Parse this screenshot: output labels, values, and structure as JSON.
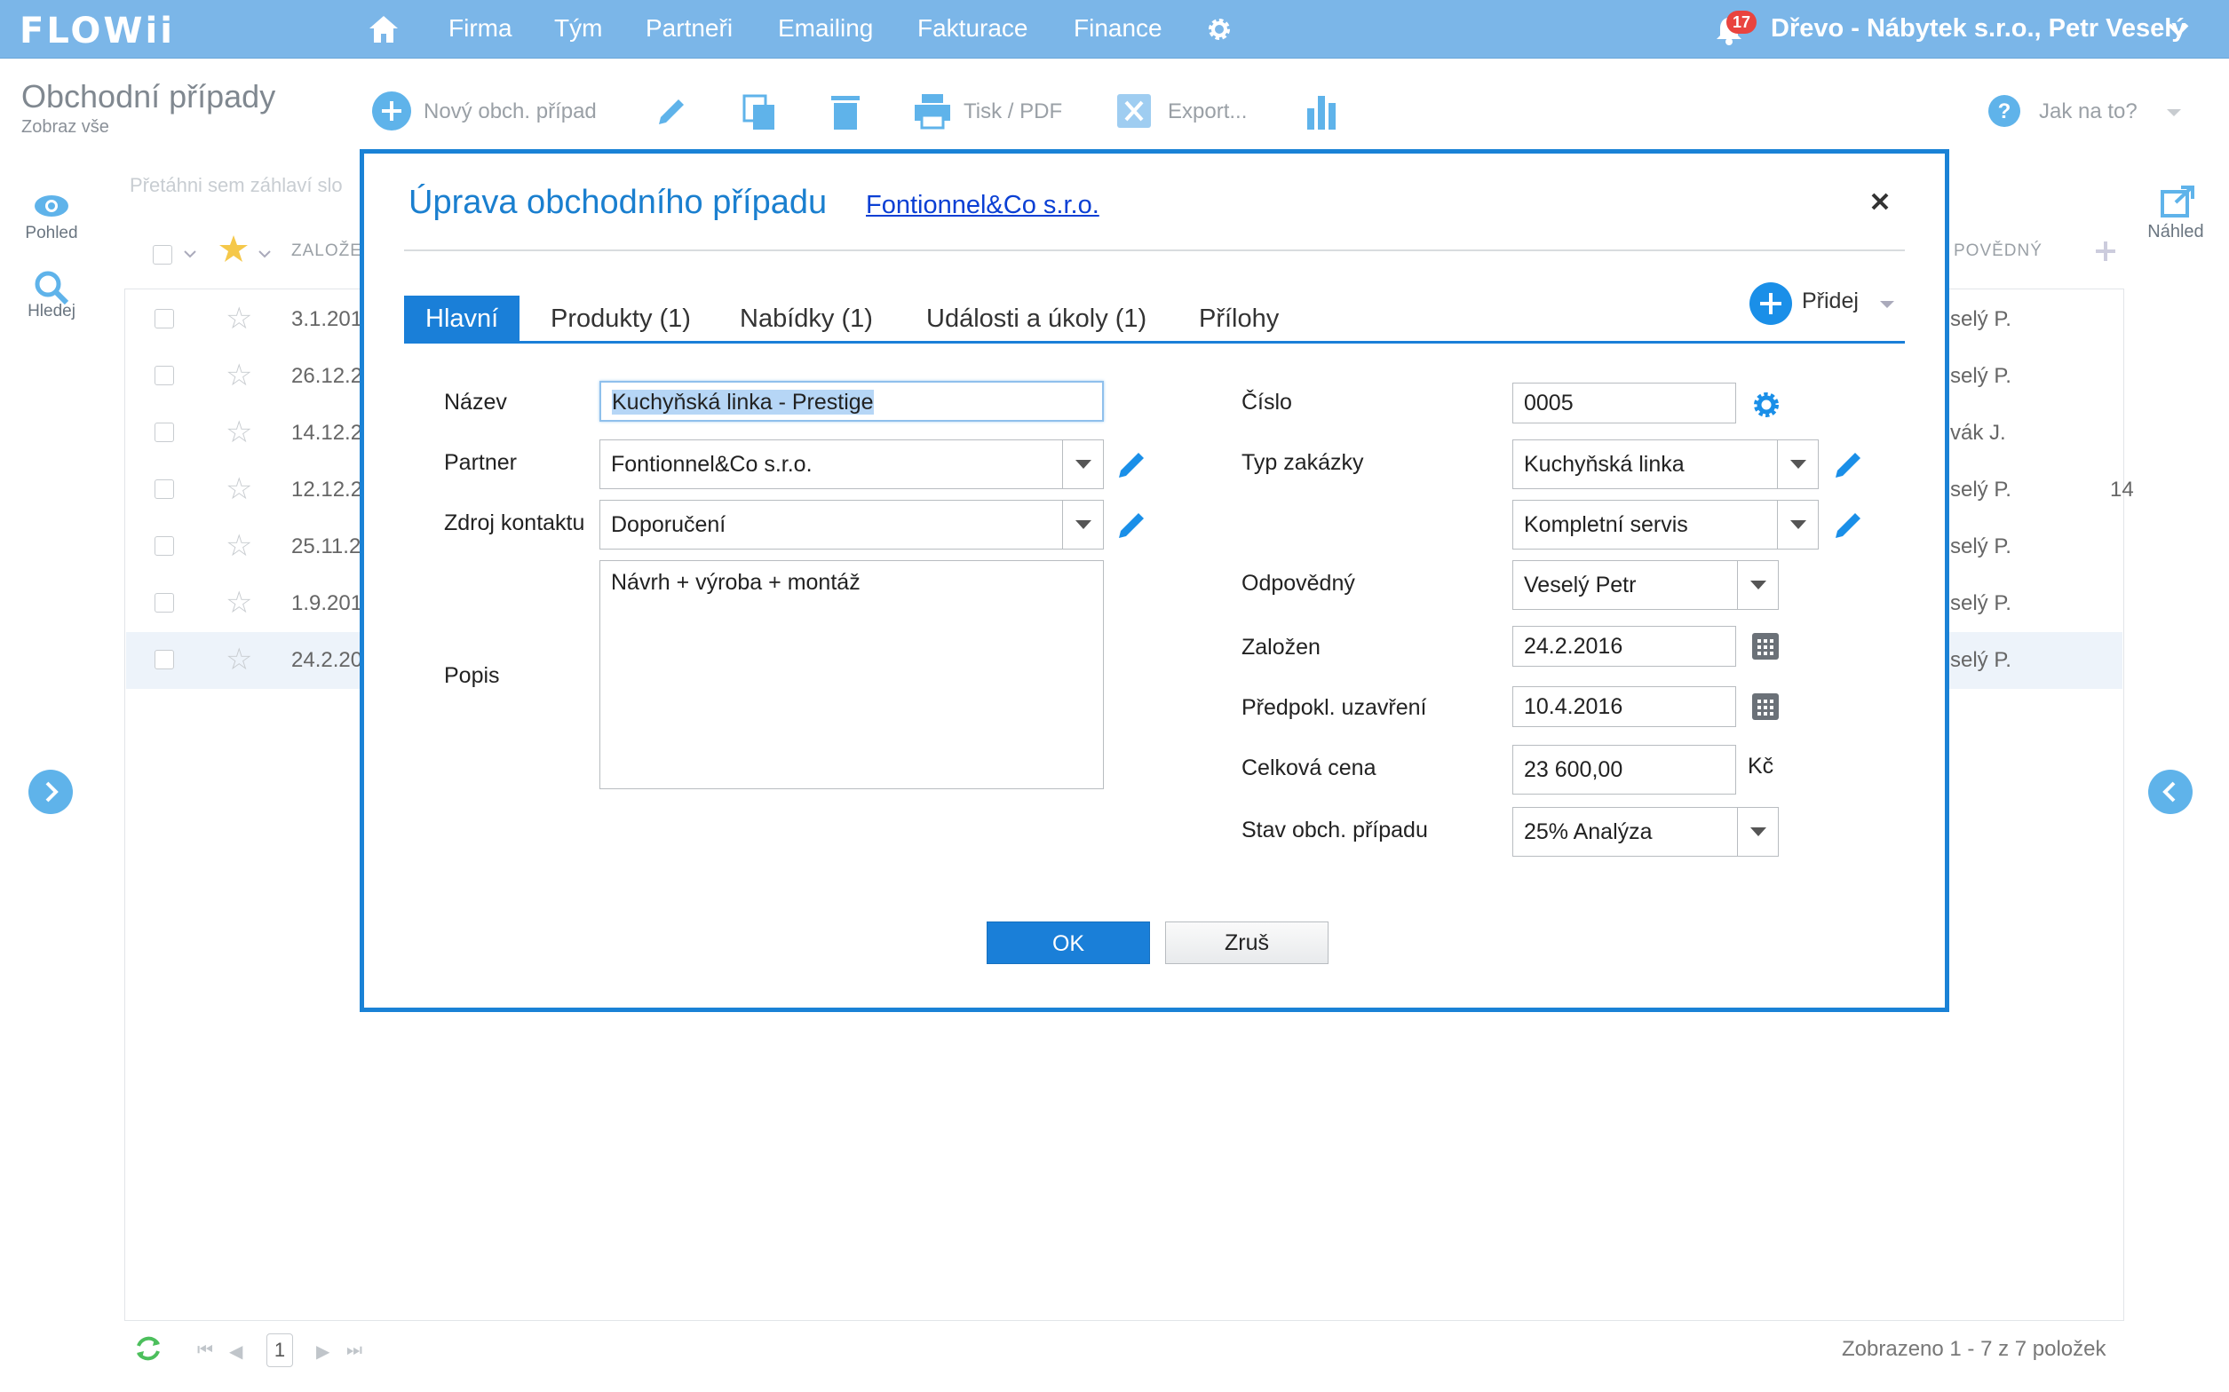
{
  "app": {
    "logo": "FLOWii",
    "nav": [
      "Firma",
      "Tým",
      "Partneři",
      "Emailing",
      "Fakturace",
      "Finance"
    ],
    "notifications": "17",
    "company_user": "Dřevo - Nábytek s.r.o., Petr Veselý"
  },
  "toolbar": {
    "title": "Obchodní případy",
    "subtitle": "Zobraz vše",
    "new_label": "Nový obch. případ",
    "print_label": "Tisk / PDF",
    "export_label": "Export...",
    "help_label": "Jak na to?"
  },
  "sidebar": {
    "view_label": "Pohled",
    "search_label": "Hledej",
    "preview_label": "Náhled"
  },
  "grid": {
    "drag_hint": "Přetáhni sem záhlaví slo",
    "col_created": "ZALOŽE",
    "col_owner": "POVĚDNÝ",
    "rows": [
      {
        "date": "3.1.201",
        "owner": "selý P.",
        "extra": ""
      },
      {
        "date": "26.12.2",
        "owner": "selý P.",
        "extra": ""
      },
      {
        "date": "14.12.2",
        "owner": "vák J.",
        "extra": ""
      },
      {
        "date": "12.12.2",
        "owner": "selý P.",
        "extra": "14"
      },
      {
        "date": "25.11.2",
        "owner": "selý P.",
        "extra": ""
      },
      {
        "date": "1.9.201",
        "owner": "selý P.",
        "extra": ""
      },
      {
        "date": "24.2.20",
        "owner": "selý P.",
        "extra": ""
      }
    ],
    "page": "1",
    "summary": "Zobrazeno 1 - 7 z 7 položek"
  },
  "modal": {
    "title": "Úprava obchodního případu",
    "partner_link": "Fontionnel&Co s.r.o.",
    "tabs": [
      "Hlavní",
      "Produkty (1)",
      "Nabídky (1)",
      "Události a úkoly (1)",
      "Přílohy"
    ],
    "add_label": "Přidej",
    "fields": {
      "name_label": "Název",
      "name_value": "Kuchyňská linka - Prestige",
      "partner_label": "Partner",
      "partner_value": "Fontionnel&Co s.r.o.",
      "source_label": "Zdroj kontaktu",
      "source_value": "Doporučení",
      "desc_label": "Popis",
      "desc_value": "Návrh + výroba + montáž",
      "number_label": "Číslo",
      "number_value": "0005",
      "type_label": "Typ zakázky",
      "type_value": "Kuchyňská linka",
      "type2_value": "Kompletní servis",
      "owner_label": "Odpovědný",
      "owner_value": "Veselý Petr",
      "created_label": "Založen",
      "created_value": "24.2.2016",
      "close_label": "Předpokl. uzavření",
      "close_value": "10.4.2016",
      "price_label": "Celková cena",
      "price_value": "23 600,00",
      "currency": "Kč",
      "state_label": "Stav obch. případu",
      "state_value": "25% Analýza"
    },
    "ok_label": "OK",
    "cancel_label": "Zruš"
  },
  "colors": {
    "nav_bg": "#7bb6e8",
    "accent": "#1a7fd8",
    "badge": "#e9443f"
  }
}
